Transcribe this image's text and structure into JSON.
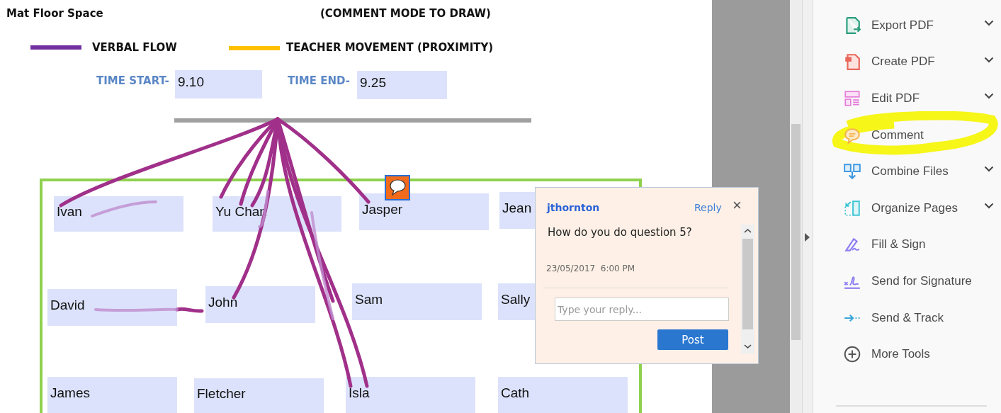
{
  "document": {
    "title": "Mat Floor Space",
    "note": "(COMMENT MODE TO DRAW)",
    "legend": [
      {
        "label": "VERBAL FLOW",
        "color": "#7030a0"
      },
      {
        "label": "TEACHER MOVEMENT (PROXIMITY)",
        "color": "#ffc000"
      }
    ],
    "time_start": {
      "label": "TIME START-",
      "value": "9.10"
    },
    "time_end": {
      "label": "TIME END-",
      "value": "9.25"
    },
    "students": [
      "Ivan",
      "Yu Chan",
      "Jasper",
      "Jean",
      "David",
      "John",
      "Sam",
      "Sally",
      "James",
      "Fletcher",
      "Isla",
      "Cath"
    ]
  },
  "comment": {
    "author": "jthornton",
    "reply": "Reply",
    "close": "×",
    "text": "How do you do question 5?",
    "timestamp": "23/05/2017  6:00 PM",
    "placeholder": "Type your reply...",
    "post": "Post"
  },
  "tools": [
    {
      "label": "Export PDF",
      "expandable": true,
      "highlighted": false
    },
    {
      "label": "Create PDF",
      "expandable": true,
      "highlighted": false
    },
    {
      "label": "Edit PDF",
      "expandable": true,
      "highlighted": false
    },
    {
      "label": "Comment",
      "expandable": false,
      "highlighted": true
    },
    {
      "label": "Combine Files",
      "expandable": true,
      "highlighted": false
    },
    {
      "label": "Organize Pages",
      "expandable": true,
      "highlighted": false
    },
    {
      "label": "Fill & Sign",
      "expandable": false,
      "highlighted": false
    },
    {
      "label": "Send for Signature",
      "expandable": false,
      "highlighted": false
    },
    {
      "label": "Send & Track",
      "expandable": false,
      "highlighted": false
    },
    {
      "label": "More Tools",
      "expandable": false,
      "highlighted": false
    }
  ]
}
